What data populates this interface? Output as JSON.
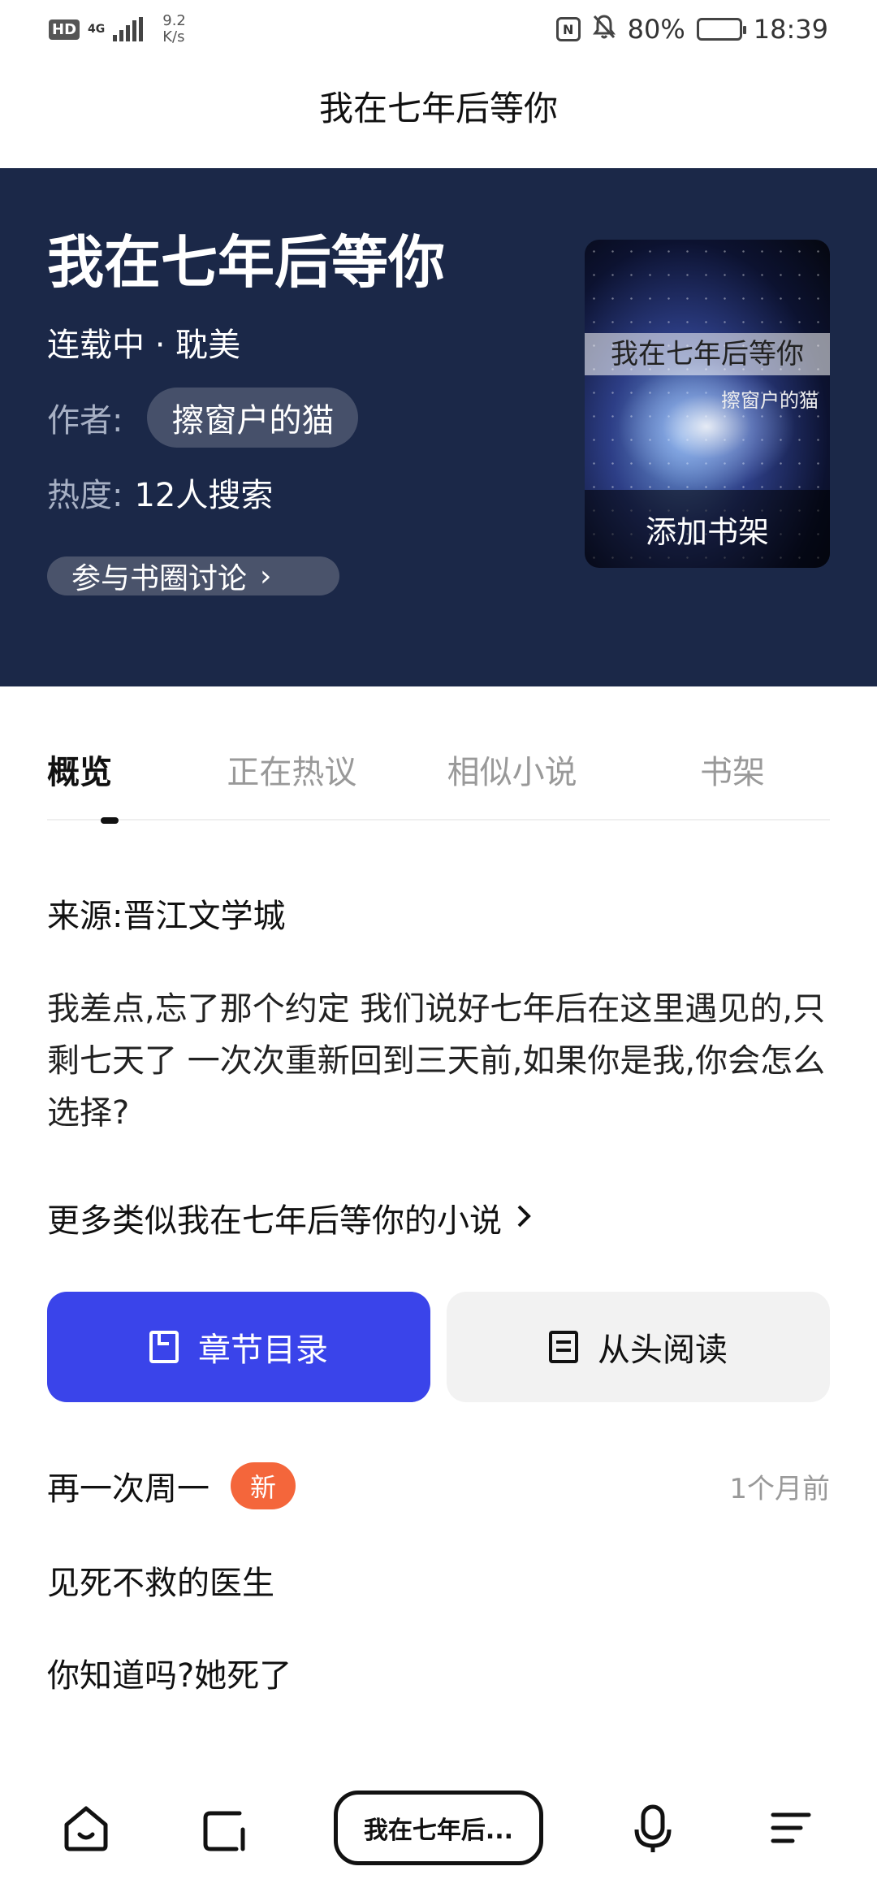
{
  "status_bar": {
    "hd": "HD",
    "network": "4G",
    "speed_value": "9.2",
    "speed_unit": "K/s",
    "nfc": "N",
    "battery_percent": "80%",
    "battery_level": 0.8,
    "time": "18:39"
  },
  "page": {
    "top_title": "我在七年后等你"
  },
  "book": {
    "title": "我在七年后等你",
    "meta": "连载中 · 耽美",
    "author_label": "作者:",
    "author": "擦窗户的猫",
    "heat_label": "热度:",
    "heat_value": "12人搜索",
    "discuss_label": "参与书圈讨论",
    "cover_title": "我在七年后等你",
    "cover_author": "擦窗户的猫",
    "add_shelf": "添加书架"
  },
  "tabs": [
    {
      "label": "概览",
      "active": true
    },
    {
      "label": "正在热议",
      "active": false
    },
    {
      "label": "相似小说",
      "active": false
    },
    {
      "label": "书架",
      "active": false
    }
  ],
  "overview": {
    "source": "来源:晋江文学城",
    "description": "我差点,忘了那个约定 我们说好七年后在这里遇见的,只剩七天了 一次次重新回到三天前,如果你是我,你会怎么选择?",
    "more_similar": "更多类似我在七年后等你的小说"
  },
  "actions": {
    "toc_label": "章节目录",
    "read_label": "从头阅读"
  },
  "chapters": {
    "latest_title": "再一次周一",
    "new_badge": "新",
    "latest_time": "1个月前",
    "items": [
      "见死不救的医生",
      "你知道吗?她死了"
    ]
  },
  "bottom_nav": {
    "query": "我在七年后..."
  },
  "colors": {
    "hero_bg": "#1b2848",
    "primary": "#3a44ea",
    "badge": "#f4663b"
  }
}
